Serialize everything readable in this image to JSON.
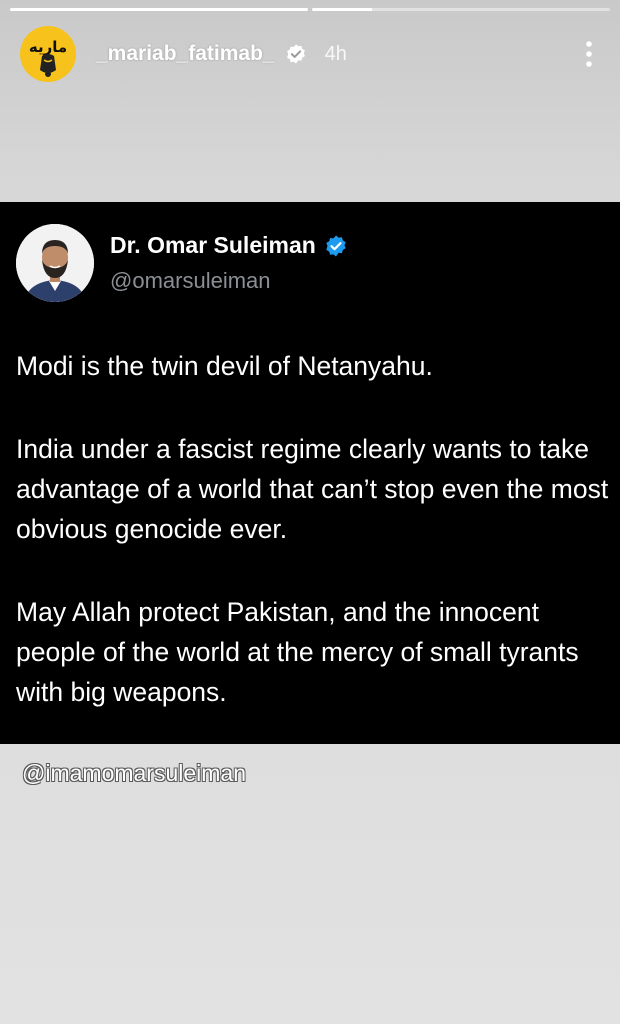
{
  "story": {
    "progress": [
      1.0,
      0.2
    ],
    "username": "_mariab_fatimab_",
    "time": "4h",
    "avatar_icon": "yellow-logo-avatar",
    "avatar_logo_text": "ماريه"
  },
  "tweet": {
    "author_name": "Dr. Omar Suleiman",
    "author_handle": "@omarsuleiman",
    "paragraphs": [
      "Modi is the twin devil of Netanyahu.",
      "India under a fascist regime clearly wants to take advantage of a world that can’t stop even the most obvious genocide ever.",
      "May Allah protect Pakistan, and the innocent people of the world at the mercy of small tyrants with big weapons."
    ],
    "background_color": "#000000",
    "verified_color": "#1d9bf0"
  },
  "mention": {
    "text": "@imamomarsuleiman"
  }
}
